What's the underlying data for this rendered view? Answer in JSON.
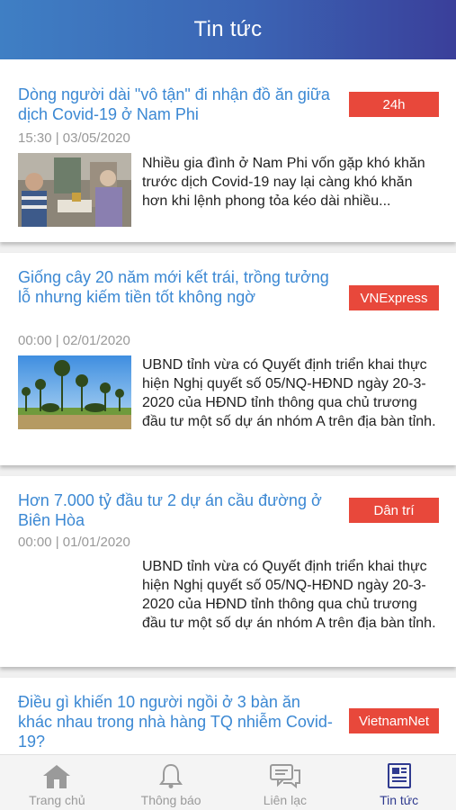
{
  "header": {
    "title": "Tin tức"
  },
  "articles": [
    {
      "title": "Dòng người dài \"vô tận\" đi nhận đồ ăn giữa dịch Covid-19 ở Nam Phi",
      "source": "24h",
      "meta": "15:30 | 03/05/2020",
      "summary": "Nhiều gia đình ở Nam Phi vốn gặp khó khăn trước dịch Covid-19 nay lại càng khó khăn hơn khi lệnh phong tỏa kéo dài nhiều..."
    },
    {
      "title": "Giống cây 20 năm mới kết trái, trồng tưởng lỗ nhưng kiếm tiền tốt không ngờ",
      "source": "VNExpress",
      "meta": "00:00 | 02/01/2020",
      "summary": "UBND tỉnh vừa có Quyết định triển khai thực hiện Nghị quyết số 05/NQ-HĐND ngày 20-3-2020 của HĐND tỉnh thông qua chủ trương đầu tư một số dự án nhóm A trên địa bàn tỉnh."
    },
    {
      "title": "Hơn 7.000 tỷ đầu tư 2 dự án cầu đường ở Biên Hòa",
      "source": "Dân trí",
      "meta": "00:00 | 01/01/2020",
      "summary": "UBND tỉnh vừa có Quyết định triển khai thực hiện Nghị quyết số 05/NQ-HĐND ngày 20-3-2020 của HĐND tỉnh thông qua chủ trương đầu tư một số dự án nhóm A trên địa bàn tỉnh."
    },
    {
      "title": "Điều gì khiến 10 người ngồi ở 3 bàn ăn khác nhau trong nhà hàng TQ nhiễm Covid-19?",
      "source": "VietnamNet"
    }
  ],
  "nav": {
    "home": "Trang chủ",
    "notifications": "Thông báo",
    "contact": "Liên lạc",
    "news": "Tin tức"
  },
  "colors": {
    "title": "#3b88d3",
    "badge": "#e8483b",
    "nav_active": "#2f3a8f"
  },
  "icons": {
    "home": "home-icon",
    "notifications": "bell-icon",
    "contact": "chat-icon",
    "news": "newspaper-icon"
  }
}
